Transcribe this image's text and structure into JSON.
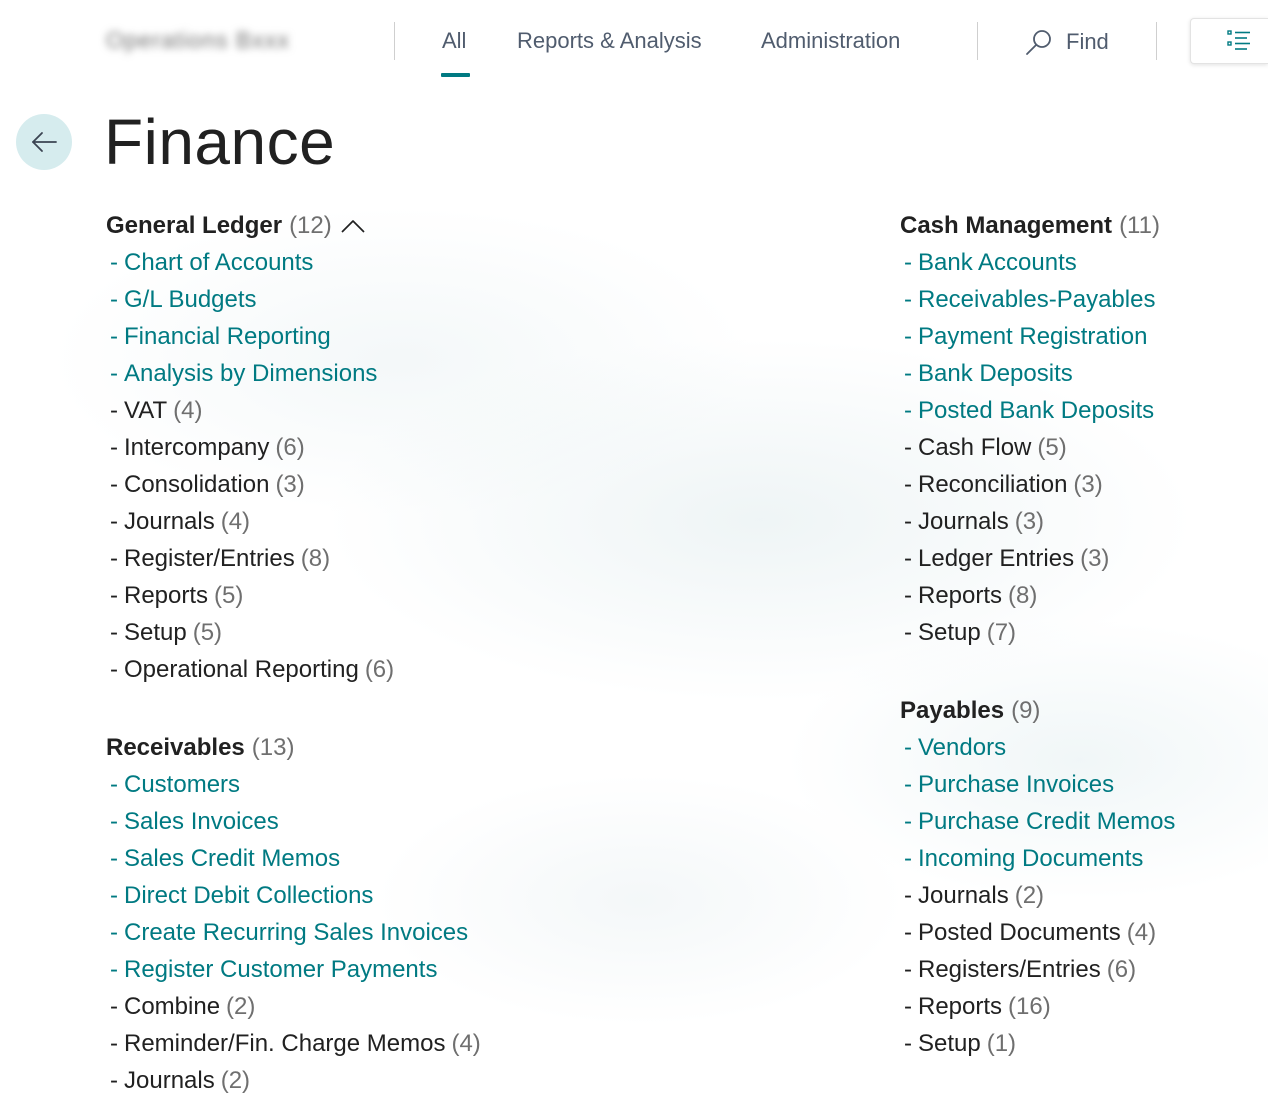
{
  "app": {
    "company_name": "Operations Bxxx"
  },
  "nav": {
    "tabs": [
      {
        "label": "All",
        "active": true
      },
      {
        "label": "Reports & Analysis",
        "active": false
      },
      {
        "label": "Administration",
        "active": false
      }
    ],
    "find_label": "Find"
  },
  "page": {
    "title": "Finance"
  },
  "colors": {
    "accent": "#007a82",
    "back_bg": "#d6ecee"
  },
  "groups": {
    "general_ledger": {
      "title": "General Ledger",
      "count": "(12)",
      "links": [
        "Chart of Accounts",
        "G/L Budgets",
        "Financial Reporting",
        "Analysis by Dimensions"
      ],
      "subgroups": [
        {
          "label": "VAT",
          "count": "(4)"
        },
        {
          "label": "Intercompany",
          "count": "(6)"
        },
        {
          "label": "Consolidation",
          "count": "(3)"
        },
        {
          "label": "Journals",
          "count": "(4)"
        },
        {
          "label": "Register/Entries",
          "count": "(8)"
        },
        {
          "label": "Reports",
          "count": "(5)"
        },
        {
          "label": "Setup",
          "count": "(5)"
        },
        {
          "label": "Operational Reporting",
          "count": "(6)"
        }
      ]
    },
    "receivables": {
      "title": "Receivables",
      "count": "(13)",
      "links": [
        "Customers",
        "Sales Invoices",
        "Sales Credit Memos",
        "Direct Debit Collections",
        "Create Recurring Sales Invoices",
        "Register Customer Payments"
      ],
      "subgroups": [
        {
          "label": "Combine",
          "count": "(2)"
        },
        {
          "label": "Reminder/Fin. Charge Memos",
          "count": "(4)"
        },
        {
          "label": "Journals",
          "count": "(2)"
        }
      ]
    },
    "cash_management": {
      "title": "Cash Management",
      "count": "(11)",
      "links": [
        "Bank Accounts",
        "Receivables-Payables",
        "Payment Registration",
        "Bank Deposits",
        "Posted Bank Deposits"
      ],
      "subgroups": [
        {
          "label": "Cash Flow",
          "count": "(5)"
        },
        {
          "label": "Reconciliation",
          "count": "(3)"
        },
        {
          "label": "Journals",
          "count": "(3)"
        },
        {
          "label": "Ledger Entries",
          "count": "(3)"
        },
        {
          "label": "Reports",
          "count": "(8)"
        },
        {
          "label": "Setup",
          "count": "(7)"
        }
      ]
    },
    "payables": {
      "title": "Payables",
      "count": "(9)",
      "links": [
        "Vendors",
        "Purchase Invoices",
        "Purchase Credit Memos",
        "Incoming Documents"
      ],
      "subgroups": [
        {
          "label": "Journals",
          "count": "(2)"
        },
        {
          "label": "Posted Documents",
          "count": "(4)"
        },
        {
          "label": "Registers/Entries",
          "count": "(6)"
        },
        {
          "label": "Reports",
          "count": "(16)"
        },
        {
          "label": "Setup",
          "count": "(1)"
        }
      ]
    }
  }
}
